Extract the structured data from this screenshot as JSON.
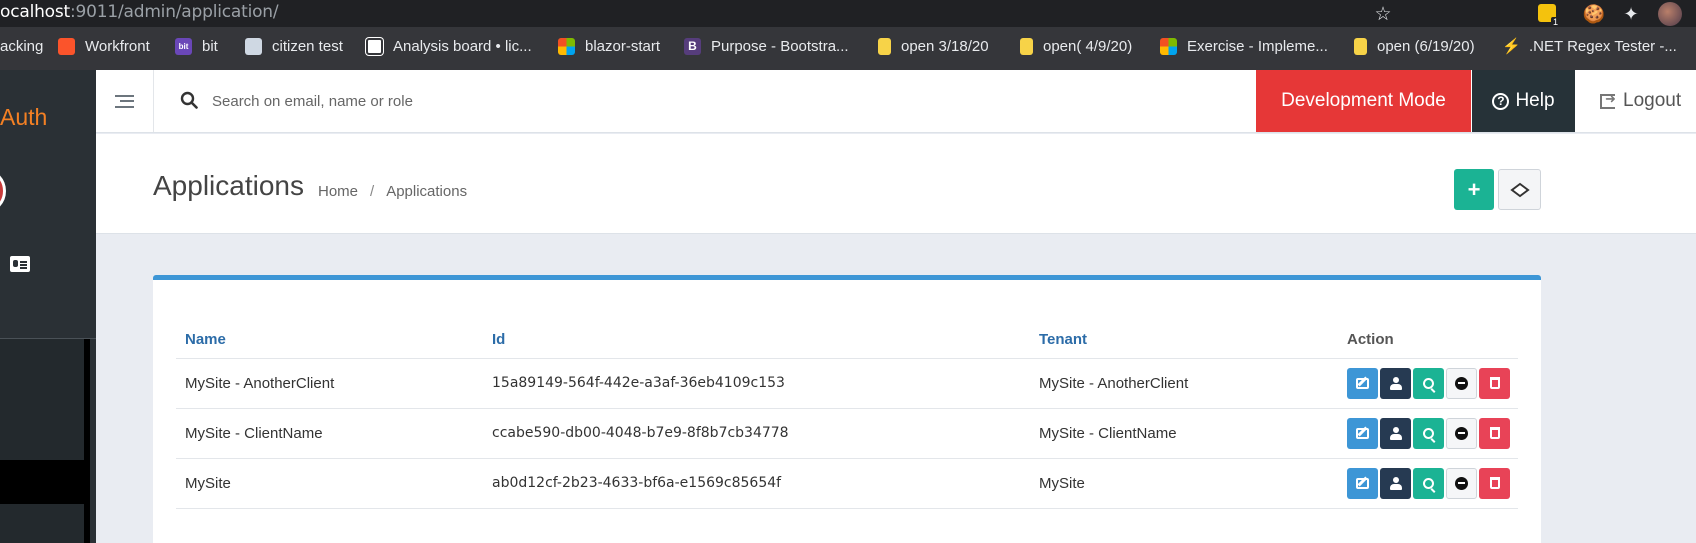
{
  "browser": {
    "url_host": "ocalhost",
    "url_rest": ":9011/admin/application/",
    "extension_badge": "1",
    "bookmarks": [
      {
        "label": "acking",
        "icon": "none"
      },
      {
        "label": "Workfront",
        "icon": "brave-lion-icon"
      },
      {
        "label": "bit",
        "icon": "bit-icon"
      },
      {
        "label": "citizen test",
        "icon": "shield-icon"
      },
      {
        "label": "Analysis board • lic...",
        "icon": "lichess-icon"
      },
      {
        "label": "blazor-start",
        "icon": "microsoft-icon"
      },
      {
        "label": "Purpose - Bootstra...",
        "icon": "bootstrap-icon"
      },
      {
        "label": "open 3/18/20",
        "icon": "note-icon"
      },
      {
        "label": "open( 4/9/20)",
        "icon": "note-icon"
      },
      {
        "label": "Exercise - Impleme...",
        "icon": "microsoft-icon"
      },
      {
        "label": "open (6/19/20)",
        "icon": "note-icon"
      },
      {
        "label": ".NET Regex Tester -...",
        "icon": "lightning-icon"
      }
    ]
  },
  "sidebar": {
    "brand": "Auth"
  },
  "topnav": {
    "search_placeholder": "Search on email, name or role",
    "dev_mode_label": "Development Mode",
    "help_label": "Help",
    "logout_label": "Logout"
  },
  "page": {
    "title": "Applications",
    "breadcrumb": [
      "Home",
      "/",
      "Applications"
    ]
  },
  "table": {
    "headers": {
      "name": "Name",
      "id": "Id",
      "tenant": "Tenant",
      "action": "Action"
    },
    "rows": [
      {
        "name": "MySite - AnotherClient",
        "id": "15a89149-564f-442e-a3af-36eb4109c153",
        "tenant": "MySite - AnotherClient"
      },
      {
        "name": "MySite - ClientName",
        "id": "ccabe590-db00-4048-b7e9-8f8b7cb34778",
        "tenant": "MySite - ClientName"
      },
      {
        "name": "MySite",
        "id": "ab0d12cf-2b23-4633-bf6a-e1569c85654f",
        "tenant": "MySite"
      }
    ]
  },
  "colors": {
    "accent_blue": "#3d96d6",
    "dev_mode_red": "#e63737",
    "success_green": "#1bb394",
    "danger_red": "#e84357",
    "brand_orange": "#f48024"
  }
}
